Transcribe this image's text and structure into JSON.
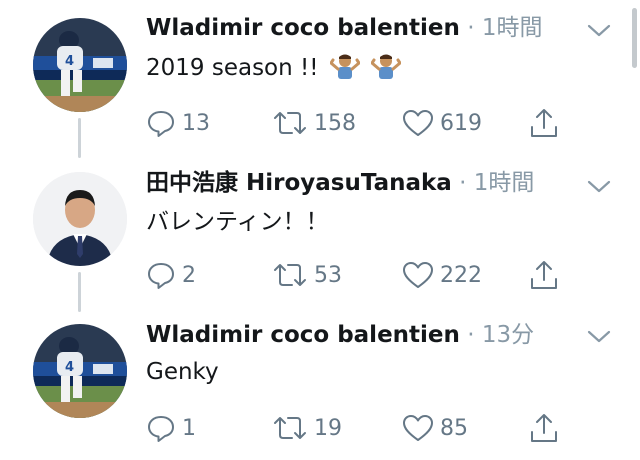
{
  "tweets": [
    {
      "author": "Wladimir coco balentien",
      "separator": "·",
      "time": "1時間",
      "text": "2019 season !!",
      "text_emoji": [
        "man-shrugging-icon",
        "man-shrugging-icon"
      ],
      "replies": "13",
      "retweets": "158",
      "likes": "619"
    },
    {
      "author": "田中浩康 HiroyasuTanaka",
      "separator": "·",
      "time": "1時間",
      "text": "バレンティン！！",
      "replies": "2",
      "retweets": "53",
      "likes": "222"
    },
    {
      "author": "Wladimir coco balentien",
      "separator": "·",
      "time": "13分",
      "text": "Genky",
      "replies": "1",
      "retweets": "19",
      "likes": "85"
    }
  ],
  "colors": {
    "text": "#14171a",
    "muted": "#657786",
    "thread_line": "#cdd3d8"
  }
}
